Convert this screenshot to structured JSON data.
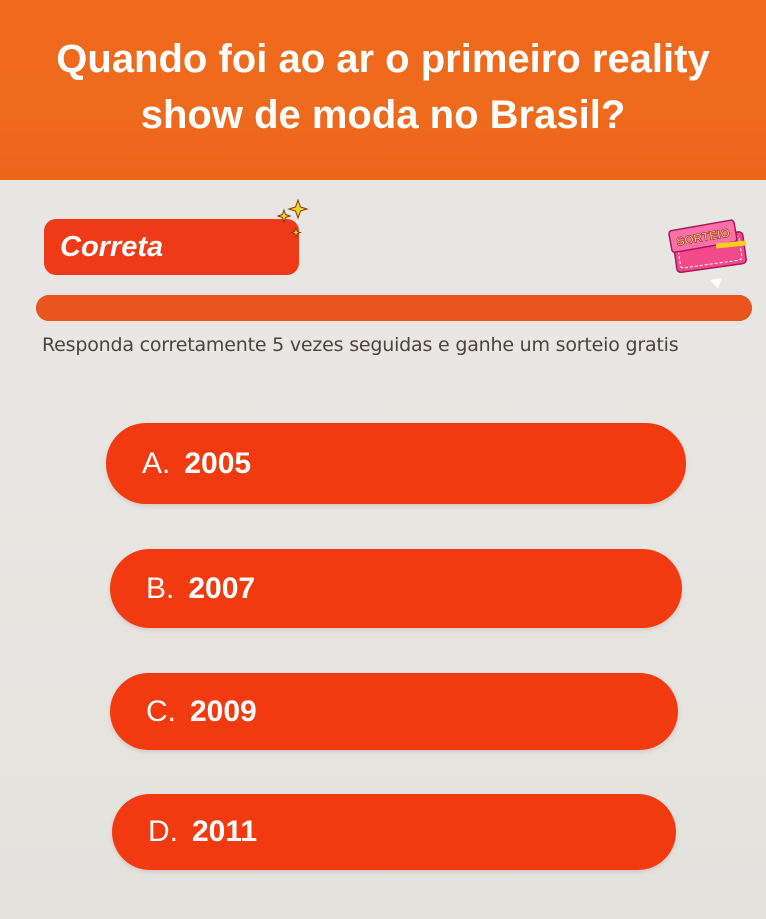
{
  "question": {
    "line1": "Quando foi ao ar o primeiro reality",
    "line2": "show de moda no Brasil?"
  },
  "status": {
    "label": "Correta"
  },
  "badge": {
    "label": "SORTEIO"
  },
  "progress": {
    "fraction": 1.0
  },
  "instruction": "Responda corretamente 5 vezes seguidas e ganhe um sorteio gratis",
  "options": [
    {
      "letter": "A.",
      "value": "2005"
    },
    {
      "letter": "B.",
      "value": "2007"
    },
    {
      "letter": "C.",
      "value": "2009"
    },
    {
      "letter": "D.",
      "value": "2011"
    }
  ],
  "colors": {
    "header": "#ee6a1d",
    "option": "#f23a10",
    "status": "#ee3a16",
    "progress": "#e9541f",
    "badge": "#f24a8a"
  }
}
